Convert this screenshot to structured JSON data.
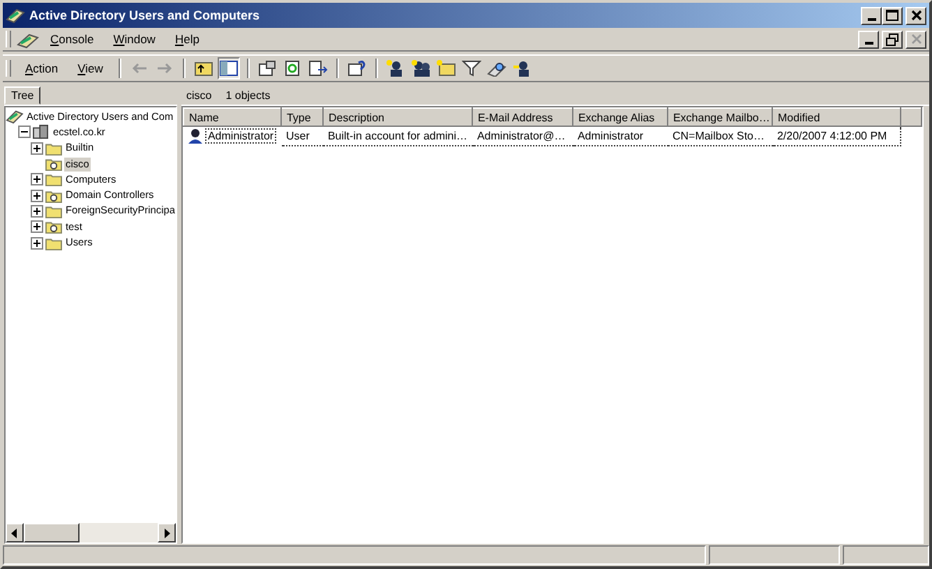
{
  "window": {
    "title": "Active Directory Users and Computers"
  },
  "menu": [
    {
      "label": "Console"
    },
    {
      "label": "Window"
    },
    {
      "label": "Help"
    }
  ],
  "toolbar_menu": [
    {
      "label": "Action"
    },
    {
      "label": "View"
    }
  ],
  "tree_tab": {
    "label": "Tree"
  },
  "tree": [
    {
      "label": "Active Directory Users and Com",
      "kind": "root",
      "expandable": false,
      "selected": false,
      "children": [
        {
          "label": "ecstel.co.kr",
          "kind": "domain",
          "expandable": true,
          "selected": false,
          "children": [
            {
              "label": "Builtin",
              "kind": "folder",
              "expandable": true,
              "selected": false
            },
            {
              "label": "cisco",
              "kind": "ou",
              "expandable": false,
              "selected": true
            },
            {
              "label": "Computers",
              "kind": "folder",
              "expandable": true,
              "selected": false
            },
            {
              "label": "Domain Controllers",
              "kind": "ou",
              "expandable": true,
              "selected": false
            },
            {
              "label": "ForeignSecurityPrincipa",
              "kind": "folder",
              "expandable": true,
              "selected": false
            },
            {
              "label": "test",
              "kind": "ou",
              "expandable": true,
              "selected": false
            },
            {
              "label": "Users",
              "kind": "folder",
              "expandable": true,
              "selected": false
            }
          ]
        }
      ]
    }
  ],
  "pane_header": {
    "container": "cisco",
    "count": "1 objects"
  },
  "table": {
    "columns": [
      "Name",
      "Type",
      "Description",
      "E-Mail Address",
      "Exchange Alias",
      "Exchange Mailbo…",
      "Modified"
    ],
    "rows": [
      {
        "focused": true,
        "cells": [
          "Administrator",
          "User",
          "Built-in account for admini…",
          "Administrator@…",
          "Administrator",
          "CN=Mailbox Sto…",
          "2/20/2007 4:12:00 PM"
        ]
      }
    ]
  }
}
